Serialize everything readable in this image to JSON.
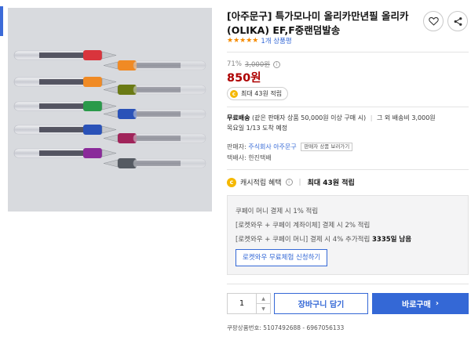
{
  "product": {
    "title": "[아주문구] 특가모나미 올리카만년필 올리카 (OLIKA) EF,F중랜덤발송",
    "rating_stars": "★★★★★",
    "review_count": "1개 상품평",
    "discount_percent": "71%",
    "original_price": "3,000원",
    "price": "850원",
    "cashback_badge": "최대 43원 적립"
  },
  "shipping": {
    "label": "무료배송",
    "condition": "(같은 판매자 상품 50,000원 이상 구매 시)",
    "other": "그 외 배송비 3,000원",
    "eta": "목요일 1/13 도착 예정"
  },
  "seller": {
    "label": "판매자:",
    "name": "주식회사 아주문구",
    "other_products": "판매자 상품 보러가기",
    "courier": "택배사: 한진택배"
  },
  "cash_benefit": {
    "label": "캐시적립 혜택",
    "max": "최대 43원 적립"
  },
  "benefits": {
    "line1": "쿠페이 머니 결제 시 1% 적립",
    "line2": "[로켓와우 + 쿠페이 계좌이체] 결제 시 2% 적립",
    "line3_prefix": "[로켓와우 + 쿠페이 머니] 결제 시 4% 추가적립",
    "line3_highlight": "3335일 남음",
    "apply_button": "로켓와우 무료체험 신청하기"
  },
  "purchase": {
    "quantity": "1",
    "cart_button": "장바구니 담기",
    "buy_button": "바로구매",
    "buy_arrow": "›"
  },
  "product_code": "쿠팡상품번호: 5107492688 - 6967056133",
  "icons": {
    "heart": "heart-icon",
    "share": "share-icon",
    "info": "info-icon",
    "coin": "coin-icon"
  },
  "colors": {
    "accent": "#3468d6",
    "price": "#ae0000",
    "stars": "#f58b00",
    "coin": "#f5b800"
  }
}
